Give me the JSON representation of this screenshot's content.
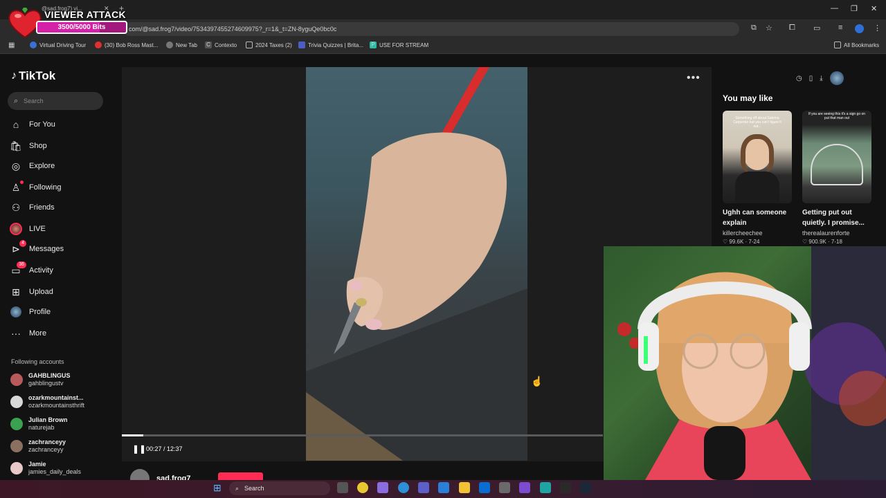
{
  "browser": {
    "tab_title": "@sad.frog7) vi...",
    "url": "com/@sad.frog7/video/7534397455274609975?_r=1&_t=ZN-8yguQe0bc0c",
    "bookmarks": [
      "Virtual Driving Tour",
      "(30) Bob Ross Mast...",
      "New Tab",
      "Contexto",
      "2024 Taxes (2)",
      "Trivia Quizzes | Brita...",
      "USE FOR STREAM"
    ],
    "all_bookmarks": "All Bookmarks",
    "new_tab_symbol": "+",
    "win_minimize": "—",
    "win_restore": "❐",
    "win_close": "✕"
  },
  "overlay": {
    "title": "VIEWER ATTACK",
    "bits_text": "3500/5000 Bits",
    "progress_fraction": 0.7,
    "colors": {
      "bar": "#a3187c",
      "fill": "#d321a8",
      "heart": "#e0242f"
    }
  },
  "tiktok": {
    "logo": "TikTok",
    "search_placeholder": "Search",
    "nav": [
      {
        "label": "For You",
        "icon": "home-icon"
      },
      {
        "label": "Shop",
        "icon": "shop-icon"
      },
      {
        "label": "Explore",
        "icon": "compass-icon"
      },
      {
        "label": "Following",
        "icon": "following-icon"
      },
      {
        "label": "Friends",
        "icon": "friends-icon"
      },
      {
        "label": "LIVE",
        "icon": "live-icon"
      },
      {
        "label": "Messages",
        "icon": "messages-icon",
        "badge": "4"
      },
      {
        "label": "Activity",
        "icon": "activity-icon",
        "badge": "36"
      },
      {
        "label": "Upload",
        "icon": "upload-icon"
      },
      {
        "label": "Profile",
        "icon": "profile-icon"
      },
      {
        "label": "More",
        "icon": "more-icon"
      }
    ],
    "following_accounts_title": "Following accounts",
    "following_accounts": [
      {
        "name": "GAHBLINGUS",
        "username": "gahblingustv"
      },
      {
        "name": "ozarkmountainst...",
        "username": "ozarkmountainsthrift"
      },
      {
        "name": "Julian Brown",
        "username": "naturejab"
      },
      {
        "name": "zachranceyy",
        "username": "zachranceyy"
      },
      {
        "name": "Jamie",
        "username": "jamies_daily_deals"
      }
    ]
  },
  "player": {
    "time": "00:27 / 12:37",
    "progress_fraction": 0.044,
    "author": "sad.frog7",
    "more": "•••",
    "pause_symbol": "❚❚"
  },
  "you_may_like": {
    "title": "You may like",
    "cards": [
      {
        "caption": "Ughh can someone explain",
        "thumb_text": "Something off about Sabrina Carpenter but you can't figure it out...",
        "user": "killercheechee",
        "likes": "99.6K",
        "date": "7-24"
      },
      {
        "caption": "Getting put out quietly. I promise...",
        "thumb_text": "If you are seeing this it's a sign go on put that man out",
        "user": "therealaurenforte",
        "likes": "900.9K",
        "date": "7-18"
      }
    ]
  },
  "taskbar": {
    "search_label": "Search",
    "accent": "#fe2c55"
  }
}
